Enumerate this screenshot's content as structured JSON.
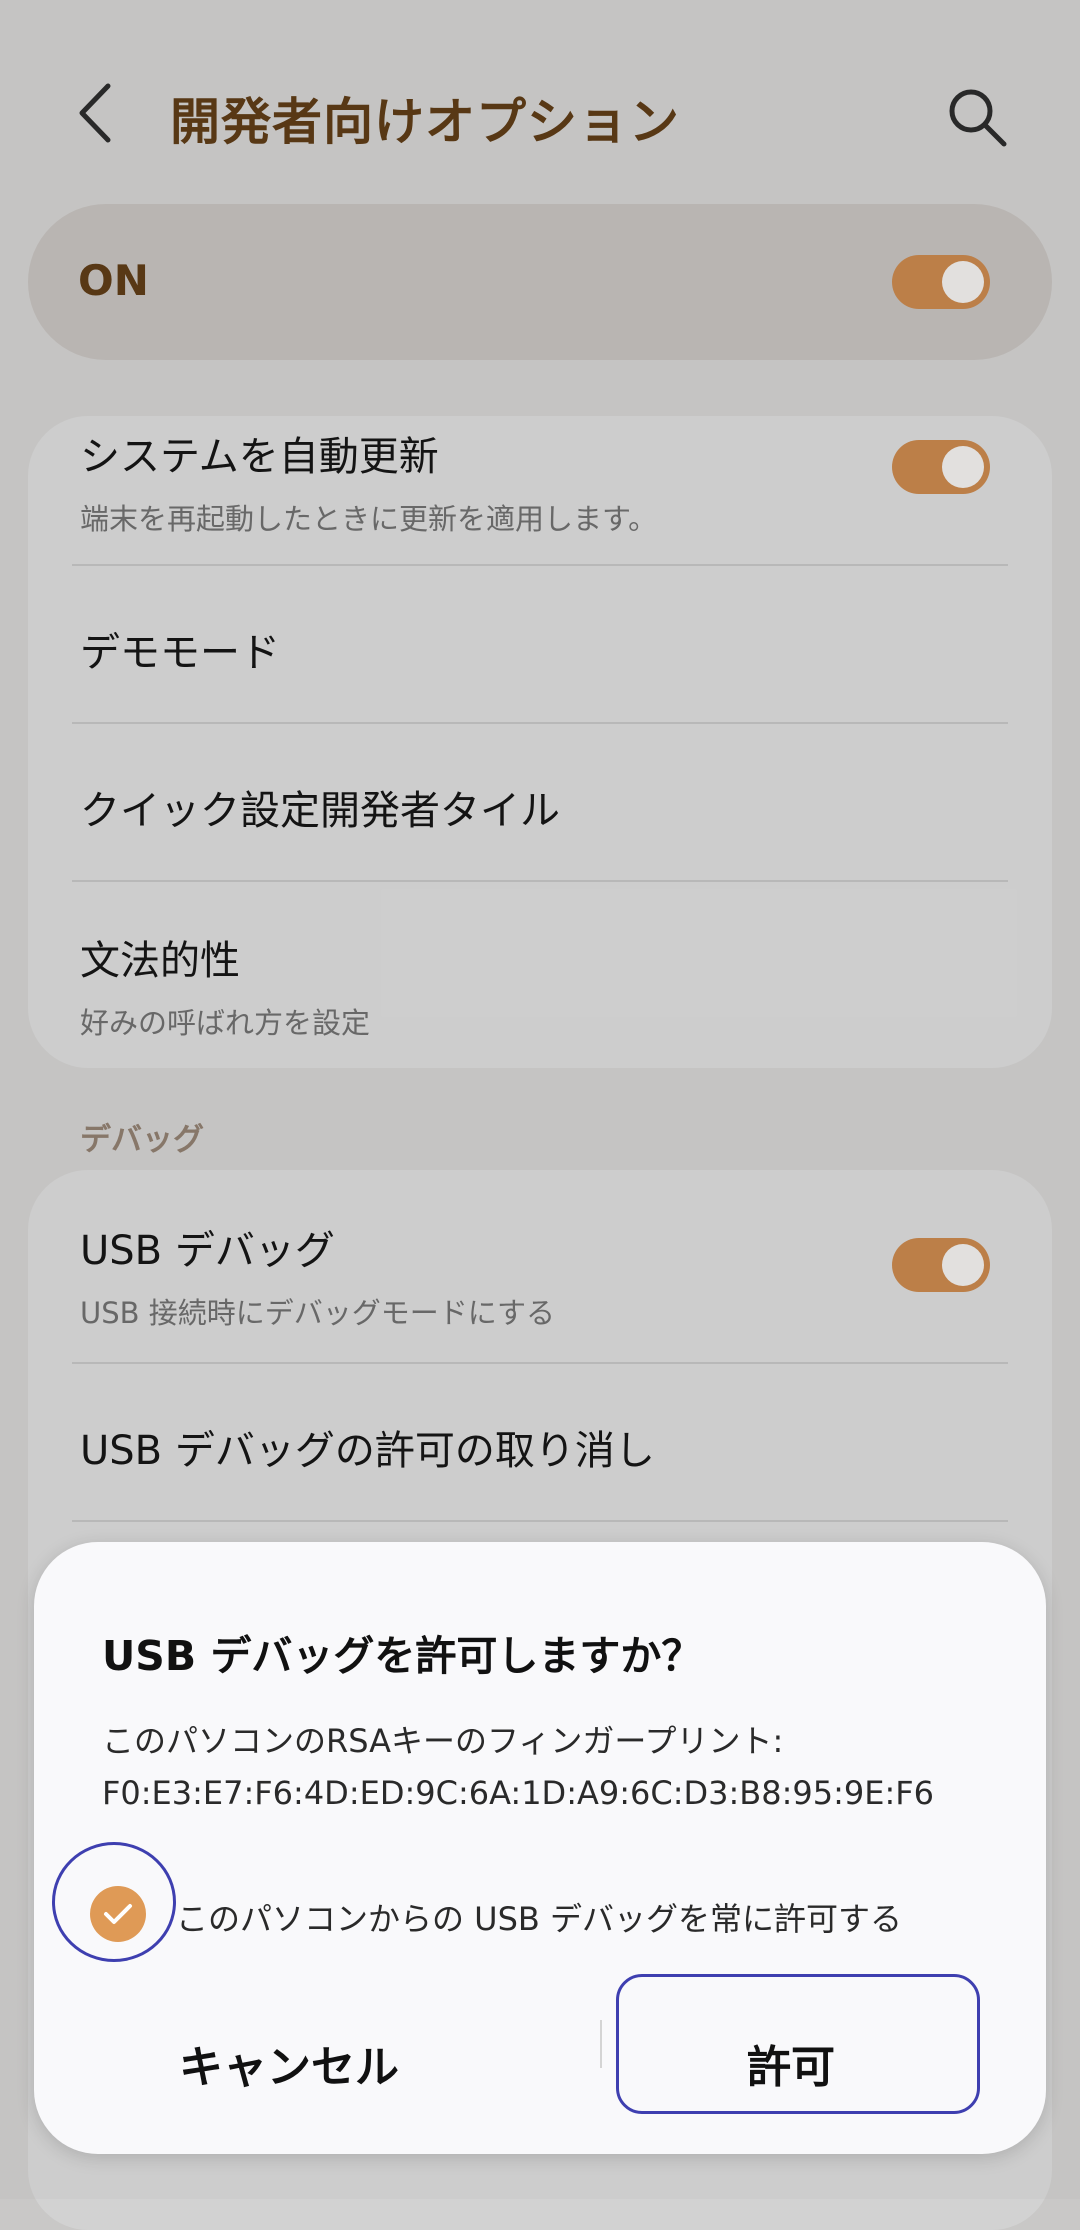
{
  "header": {
    "title": "開発者向けオプション"
  },
  "master": {
    "label": "ON",
    "enabled": true
  },
  "settings": [
    {
      "title": "システムを自動更新",
      "subtitle": "端末を再起動したときに更新を適用します。",
      "toggle": true
    },
    {
      "title": "デモモード"
    },
    {
      "title": "クイック設定開発者タイル"
    },
    {
      "title": "文法的性",
      "subtitle": "好みの呼ばれ方を設定"
    }
  ],
  "debug": {
    "section_label": "デバッグ",
    "items": [
      {
        "title": "USB デバッグ",
        "subtitle": "USB 接続時にデバッグモードにする",
        "toggle": true
      },
      {
        "title": "USB デバッグの許可の取り消し"
      }
    ]
  },
  "dialog": {
    "title": "USB デバッグを許可しますか？",
    "message_line1": "このパソコンのRSAキーのフィンガープリント:",
    "message_line2": "F0:E3:E7:F6:4D:ED:9C:6A:1D:A9:6C:D3:B8:95:9E:F6",
    "checkbox_label": "このパソコンからの USB デバッグを常に許可する",
    "checkbox_checked": true,
    "cancel_label": "キャンセル",
    "allow_label": "許可"
  },
  "colors": {
    "accent": "#c0824a",
    "title": "#5a3a16",
    "annotation": "#3e3fb0"
  }
}
